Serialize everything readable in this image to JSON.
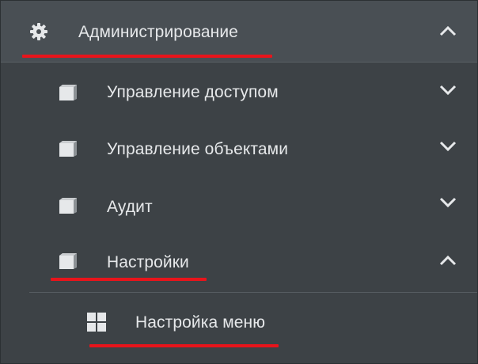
{
  "menu": {
    "admin": {
      "label": "Администрирование",
      "icon": "gear-icon",
      "expanded": true
    },
    "items": [
      {
        "label": "Управление доступом",
        "icon": "book-icon",
        "expanded": false
      },
      {
        "label": "Управление объектами",
        "icon": "book-icon",
        "expanded": false
      },
      {
        "label": "Аудит",
        "icon": "book-icon",
        "expanded": false
      },
      {
        "label": "Настройки",
        "icon": "book-icon",
        "expanded": true
      }
    ],
    "subitems": [
      {
        "label": "Настройка меню",
        "icon": "grid-icon"
      }
    ]
  },
  "colors": {
    "background": "#3d4246",
    "header_background": "#494f54",
    "text": "#e6e8ea",
    "highlight_underline": "#e8141b"
  }
}
